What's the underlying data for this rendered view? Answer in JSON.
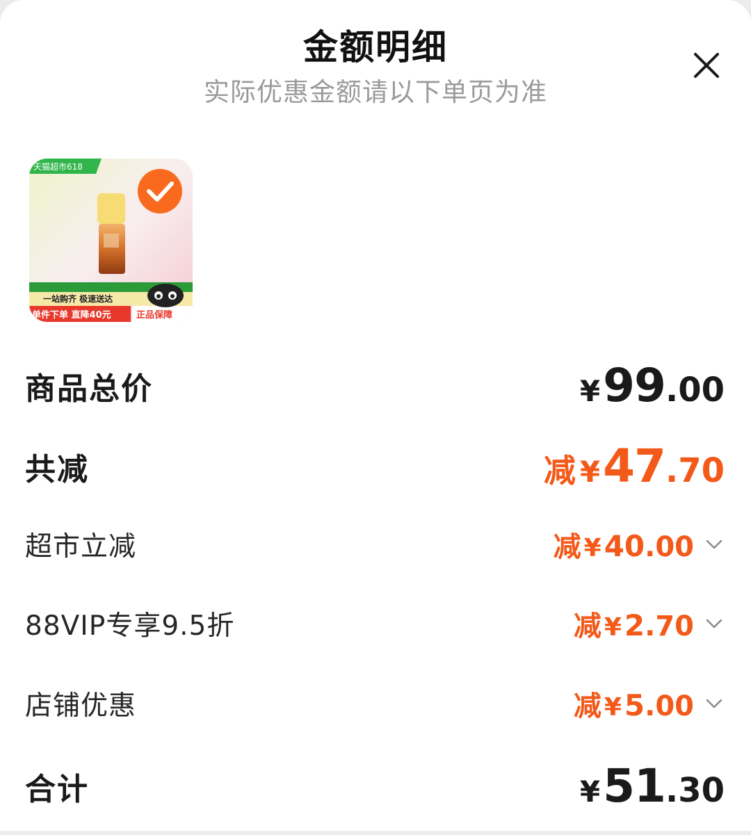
{
  "header": {
    "title": "金额明细",
    "subtitle": "实际优惠金额请以下单页为准",
    "close_icon": "close-icon"
  },
  "product": {
    "badge": "天猫超市618",
    "banner_line1": "一站购齐 极速送达",
    "banner_line2": "单件下单 直降40元",
    "banner_tag": "正品保障",
    "selected": true,
    "check_icon": "check-circle-icon"
  },
  "rows": {
    "total": {
      "label": "商品总价",
      "yen": "¥",
      "int": "99",
      "dec": ".00"
    },
    "reduce": {
      "label": "共减",
      "prefix": "减",
      "yen": "¥",
      "int": "47",
      "dec": ".70"
    },
    "items": [
      {
        "label": "超市立减",
        "prefix": "减",
        "yen": "¥",
        "int": "40",
        "dec": ".00"
      },
      {
        "label": "88VIP专享9.5折",
        "prefix": "减",
        "yen": "¥",
        "int": "2",
        "dec": ".70"
      },
      {
        "label": "店铺优惠",
        "prefix": "减",
        "yen": "¥",
        "int": "5",
        "dec": ".00"
      }
    ],
    "sum": {
      "label": "合计",
      "yen": "¥",
      "int": "51",
      "dec": ".30"
    }
  },
  "colors": {
    "accent": "#f35a1a",
    "text": "#1a1a1a",
    "muted": "#9a9a9a",
    "check": "#f96a1e"
  }
}
